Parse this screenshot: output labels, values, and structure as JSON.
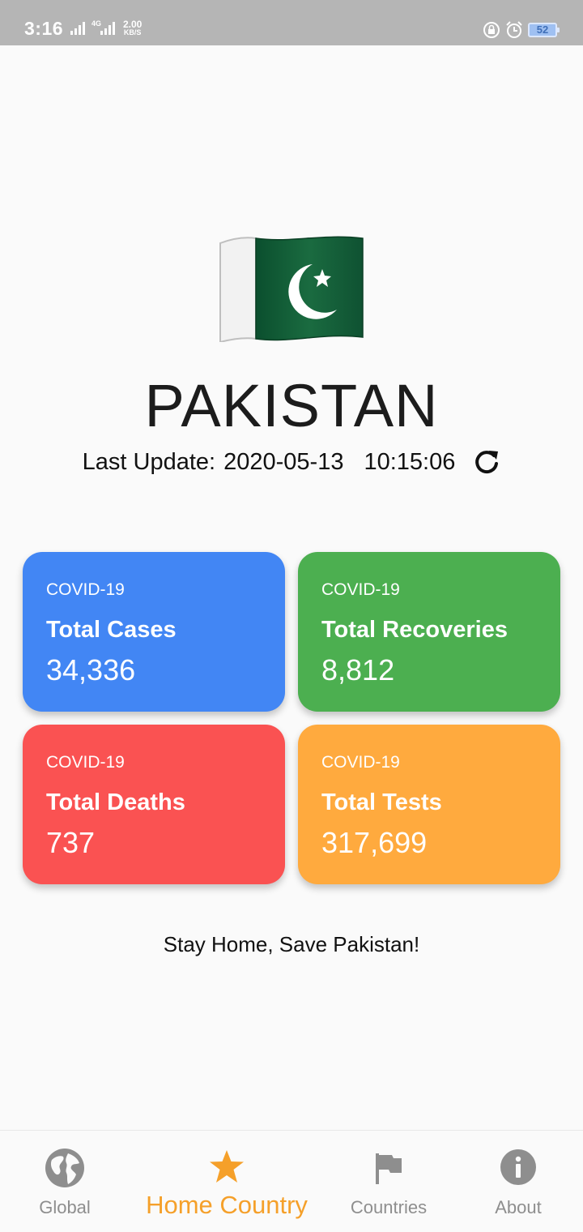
{
  "status_bar": {
    "time": "3:16",
    "network": "4G",
    "speed_value": "2.00",
    "speed_unit": "KB/S",
    "battery": "52"
  },
  "header": {
    "country": "PAKISTAN",
    "last_update_label": "Last Update:",
    "date": "2020-05-13",
    "time": "10:15:06"
  },
  "cards": [
    {
      "tag": "COVID-19",
      "title": "Total Cases",
      "value": "34,336",
      "color": "#4286f4"
    },
    {
      "tag": "COVID-19",
      "title": "Total Recoveries",
      "value": "8,812",
      "color": "#4caf50"
    },
    {
      "tag": "COVID-19",
      "title": "Total Deaths",
      "value": "737",
      "color": "#fa5252"
    },
    {
      "tag": "COVID-19",
      "title": "Total Tests",
      "value": "317,699",
      "color": "#ffaa3e"
    }
  ],
  "slogan": "Stay Home, Save Pakistan!",
  "nav": {
    "items": [
      {
        "label": "Global",
        "icon": "globe-icon"
      },
      {
        "label": "Home Country",
        "icon": "star-icon",
        "active": true
      },
      {
        "label": "Countries",
        "icon": "flag-icon"
      },
      {
        "label": "About",
        "icon": "info-icon"
      }
    ],
    "active_color": "#f5a02a"
  }
}
